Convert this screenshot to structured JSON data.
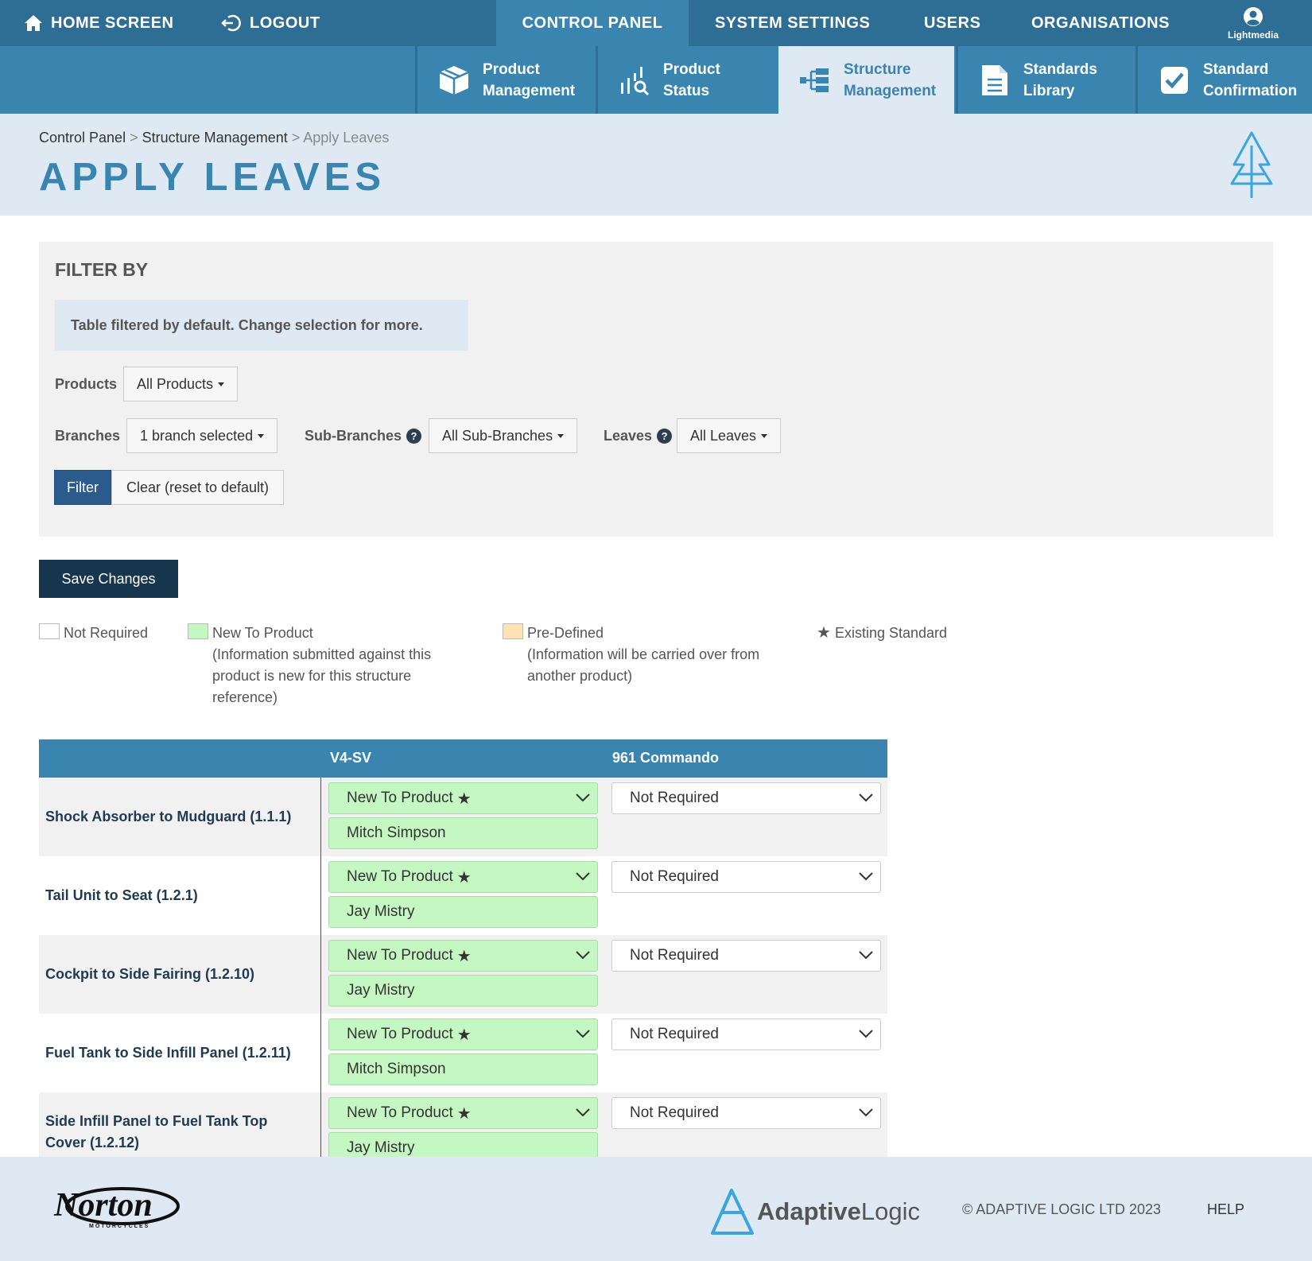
{
  "topnav": {
    "home": "HOME SCREEN",
    "logout": "LOGOUT",
    "control_panel": "CONTROL PANEL",
    "system_settings": "SYSTEM SETTINGS",
    "users": "USERS",
    "organisations": "ORGANISATIONS",
    "user_name": "Lightmedia"
  },
  "subnav": {
    "items": [
      {
        "line1": "Product",
        "line2": "Management",
        "icon": "box-icon"
      },
      {
        "line1": "Product",
        "line2": "Status",
        "icon": "chart-search-icon"
      },
      {
        "line1": "Structure",
        "line2": "Management",
        "icon": "hierarchy-icon",
        "active": true
      },
      {
        "line1": "Standards",
        "line2": "Library",
        "icon": "document-icon"
      },
      {
        "line1": "Standard",
        "line2": "Confirmation",
        "icon": "checkbox-icon"
      }
    ]
  },
  "breadcrumb": {
    "crumb1": "Control Panel",
    "crumb2": "Structure Management",
    "current": "Apply Leaves",
    "separator": ">"
  },
  "page_title": "APPLY LEAVES",
  "filter": {
    "title": "FILTER BY",
    "notice": "Table filtered by default. Change selection for more.",
    "products_label": "Products",
    "products_value": "All Products",
    "branches_label": "Branches",
    "branches_value": "1 branch selected",
    "subbranches_label": "Sub-Branches",
    "subbranches_value": "All Sub-Branches",
    "leaves_label": "Leaves",
    "leaves_value": "All Leaves",
    "help_glyph": "?",
    "filter_button": "Filter",
    "clear_button": "Clear (reset to default)"
  },
  "save_button": "Save Changes",
  "legend": {
    "not_required": "Not Required",
    "new_to_product": "New To Product",
    "new_to_product_desc": "(Information submitted against this product is new for this structure reference)",
    "pre_defined": "Pre-Defined",
    "pre_defined_desc": "(Information will be carried over from another product)",
    "existing_standard": "Existing Standard",
    "star": "★",
    "colors": {
      "new": "#c5f7c2",
      "predefined": "#fde3b3",
      "not_required": "#ffffff"
    }
  },
  "table": {
    "columns": [
      "V4-SV",
      "961 Commando"
    ],
    "star": "★",
    "rows": [
      {
        "label": "Shock Absorber to Mudguard (1.1.1)",
        "col1_status": "New To Product",
        "col1_person": "Mitch Simpson",
        "col2_status": "Not Required"
      },
      {
        "label": "Tail Unit to Seat (1.2.1)",
        "col1_status": "New To Product",
        "col1_person": "Jay Mistry",
        "col2_status": "Not Required"
      },
      {
        "label": "Cockpit to Side Fairing (1.2.10)",
        "col1_status": "New To Product",
        "col1_person": "Jay Mistry",
        "col2_status": "Not Required"
      },
      {
        "label": "Fuel Tank to Side Infill Panel (1.2.11)",
        "col1_status": "New To Product",
        "col1_person": "Mitch Simpson",
        "col2_status": "Not Required"
      },
      {
        "label": "Side Infill Panel to Fuel Tank Top Cover (1.2.12)",
        "col1_status": "New To Product",
        "col1_person": "Jay Mistry",
        "col2_status": "Not Required"
      }
    ]
  },
  "footer": {
    "norton_logo": "Norton",
    "norton_sub": "MOTORCYCLES",
    "adaptive": "Adaptive",
    "logic": "Logic",
    "copyright": "© ADAPTIVE LOGIC LTD 2023",
    "help": "HELP"
  }
}
